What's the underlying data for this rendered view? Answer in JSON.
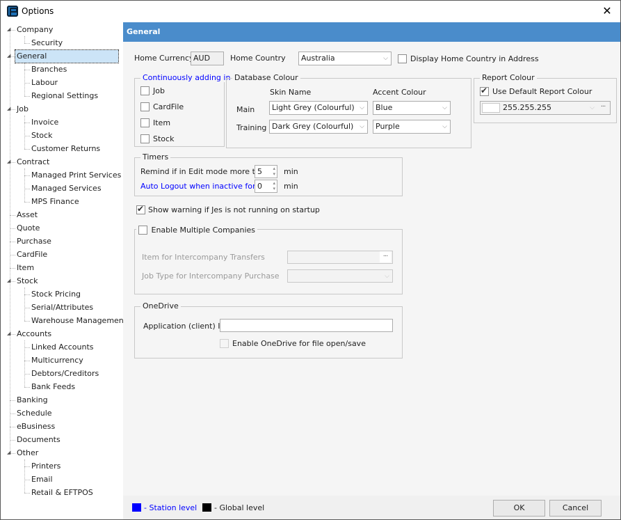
{
  "window": {
    "title": "Options",
    "close_icon": "close-icon"
  },
  "tree": {
    "items": [
      {
        "label": "Company",
        "level": 0,
        "expanded": true
      },
      {
        "label": "Security",
        "level": 1
      },
      {
        "label": "General",
        "level": 0,
        "expanded": true,
        "selected": true
      },
      {
        "label": "Branches",
        "level": 1
      },
      {
        "label": "Labour",
        "level": 1
      },
      {
        "label": "Regional Settings",
        "level": 1
      },
      {
        "label": "Job",
        "level": 0,
        "expanded": true
      },
      {
        "label": "Invoice",
        "level": 1
      },
      {
        "label": "Stock",
        "level": 1
      },
      {
        "label": "Customer Returns",
        "level": 1
      },
      {
        "label": "Contract",
        "level": 0,
        "expanded": true
      },
      {
        "label": "Managed Print Services",
        "level": 1
      },
      {
        "label": "Managed Services",
        "level": 1
      },
      {
        "label": "MPS Finance",
        "level": 1
      },
      {
        "label": "Asset",
        "level": 0
      },
      {
        "label": "Quote",
        "level": 0
      },
      {
        "label": "Purchase",
        "level": 0
      },
      {
        "label": "CardFile",
        "level": 0
      },
      {
        "label": "Item",
        "level": 0
      },
      {
        "label": "Stock",
        "level": 0,
        "expanded": true
      },
      {
        "label": "Stock Pricing",
        "level": 1
      },
      {
        "label": "Serial/Attributes",
        "level": 1
      },
      {
        "label": "Warehouse Management",
        "level": 1
      },
      {
        "label": "Accounts",
        "level": 0,
        "expanded": true
      },
      {
        "label": "Linked Accounts",
        "level": 1
      },
      {
        "label": "Multicurrency",
        "level": 1
      },
      {
        "label": "Debtors/Creditors",
        "level": 1
      },
      {
        "label": "Bank Feeds",
        "level": 1
      },
      {
        "label": "Banking",
        "level": 0
      },
      {
        "label": "Schedule",
        "level": 0
      },
      {
        "label": "eBusiness",
        "level": 0
      },
      {
        "label": "Documents",
        "level": 0
      },
      {
        "label": "Other",
        "level": 0,
        "expanded": true
      },
      {
        "label": "Printers",
        "level": 1
      },
      {
        "label": "Email",
        "level": 1
      },
      {
        "label": "Retail & EFTPOS",
        "level": 1
      }
    ]
  },
  "panel": {
    "header": "General",
    "home_currency": {
      "label": "Home Currency",
      "value": "AUD"
    },
    "home_country": {
      "label": "Home Country",
      "value": "Australia"
    },
    "display_home_country": {
      "label": "Display Home Country in Address",
      "checked": false
    },
    "continuously_adding": {
      "title": "Continuously adding in",
      "items": [
        {
          "label": "Job",
          "checked": false
        },
        {
          "label": "CardFile",
          "checked": false
        },
        {
          "label": "Item",
          "checked": false
        },
        {
          "label": "Stock",
          "checked": false
        }
      ]
    },
    "database_colour": {
      "title": "Database Colour",
      "skin_header": "Skin Name",
      "accent_header": "Accent Colour",
      "rows": [
        {
          "label": "Main",
          "skin": "Light Grey (Colourful)",
          "accent": "Blue"
        },
        {
          "label": "Training",
          "skin": "Dark Grey (Colourful)",
          "accent": "Purple"
        }
      ]
    },
    "report_colour": {
      "title": "Report Colour",
      "use_default": {
        "label": "Use Default Report Colour",
        "checked": true
      },
      "value": "255.255.255"
    },
    "timers": {
      "title": "Timers",
      "remind": {
        "label": "Remind if in Edit mode more than",
        "value": "5",
        "unit": "min"
      },
      "auto_logout": {
        "label": "Auto Logout when inactive for",
        "value": "0",
        "unit": "min"
      }
    },
    "show_warning": {
      "label": "Show warning if Jes is not running on startup",
      "checked": true
    },
    "multiple_companies": {
      "label": "Enable Multiple Companies",
      "checked": false,
      "item_transfers": {
        "label": "Item for Intercompany Transfers",
        "value": ""
      },
      "job_type": {
        "label": "Job Type for Intercompany Purchase",
        "value": ""
      }
    },
    "onedrive": {
      "title": "OneDrive",
      "client_id": {
        "label": "Application (client) ID",
        "value": ""
      },
      "enable": {
        "label": "Enable OneDrive for file open/save",
        "checked": false
      }
    }
  },
  "footer": {
    "station_label": "- Station level",
    "global_label": "- Global level",
    "station_color": "#0000ff",
    "global_color": "#000000",
    "ok_label": "OK",
    "cancel_label": "Cancel"
  }
}
